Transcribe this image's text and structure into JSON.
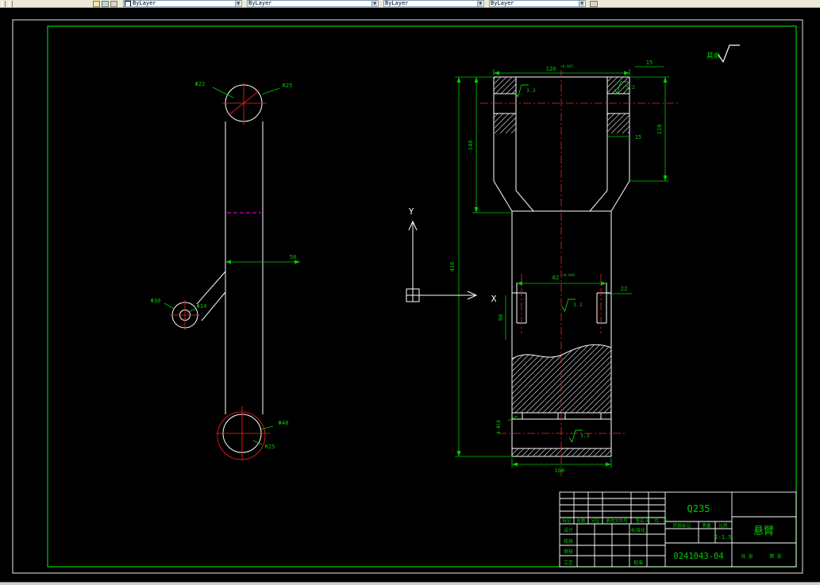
{
  "colors": {
    "background": "#000000",
    "outline": "#ffffff",
    "dimension": "#00cc00",
    "centerline": "#ff0000",
    "phantom": "#ff00ff",
    "frame": "#00cc00",
    "chrome": "#ece9d8"
  },
  "toolbar": {
    "controls": [
      {
        "label": "ByLayer"
      },
      {
        "label": "ByLayer"
      },
      {
        "label": "ByLayer"
      },
      {
        "label": "ByLayer"
      }
    ]
  },
  "ucs": {
    "x_label": "X",
    "y_label": "Y"
  },
  "notes": {
    "general_roughness": "其余",
    "roughness_value": "3.2"
  },
  "left_view": {
    "dia_top_hole": "Φ22",
    "radius_top": "R25",
    "width": "50",
    "dia_boss": "Φ30",
    "dia_boss_hole": "Φ14",
    "dia_bottom_hole": "Φ48",
    "radius_bottom": "R25"
  },
  "right_view": {
    "overall_height": "416",
    "fork_height": "148",
    "fork_span": "120",
    "fork_span_tol": "+0.047",
    "pad_width_top": "15",
    "arm_height": "110",
    "arm_width": "15",
    "slot_span": "82",
    "slot_span_tol": "+0.046",
    "notch_width": "22",
    "slot_depth": "90",
    "base_holes": "4-Φ18",
    "base_width": "106"
  },
  "title_block": {
    "material": "Q235",
    "part_name": "悬臂",
    "drawing_number": "0241043-04",
    "scale_value": "1:1.5",
    "rev_headers": {
      "mark": "标记",
      "count": "处数",
      "zone": "分区",
      "doc": "更改文件号",
      "sign": "签名",
      "date": "年、月、日"
    },
    "signs": {
      "design": "设计",
      "check": "校核",
      "review": "审核",
      "process": "工艺",
      "standard": "标准化",
      "approve": "批准"
    },
    "fields": {
      "stage": "阶段标记",
      "weight": "质量",
      "scale": "比例",
      "sheet_total": "共 张",
      "sheet_index": "第 张"
    }
  }
}
